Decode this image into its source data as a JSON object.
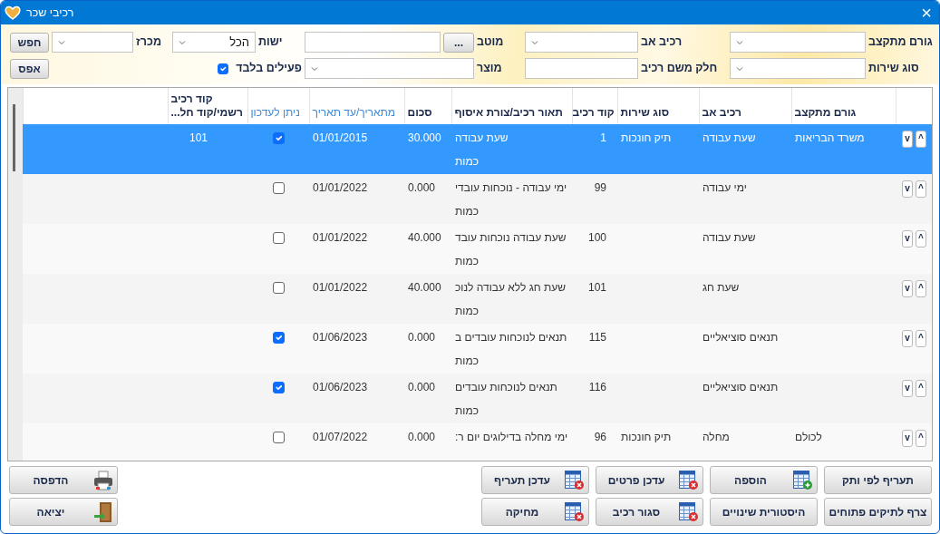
{
  "window": {
    "title": "רכיבי שכר",
    "close": "×"
  },
  "filter_rows": [
    [
      {
        "kind": "label",
        "text": "גורם מתקצב"
      },
      {
        "kind": "select"
      },
      {
        "kind": "label",
        "text": "רכיב אב"
      },
      {
        "kind": "select"
      },
      {
        "kind": "label",
        "text": "מוטב"
      },
      {
        "kind": "button",
        "text": "..."
      },
      {
        "kind": "input"
      },
      {
        "kind": "label",
        "text": "ישות"
      },
      {
        "kind": "select",
        "value": "הכל"
      },
      {
        "kind": "label",
        "text": "מכרז"
      },
      {
        "kind": "select"
      },
      {
        "kind": "button",
        "text": "חפש"
      }
    ],
    [
      {
        "kind": "label",
        "text": "סוג שירות"
      },
      {
        "kind": "select"
      },
      {
        "kind": "label",
        "text": "חלק משם רכיב"
      },
      {
        "kind": "input"
      },
      {
        "kind": "label",
        "text": "מוצר"
      },
      {
        "kind": "wide-select"
      },
      {
        "kind": "checkbox",
        "text": "פעילים בלבד",
        "checked": true
      },
      {
        "kind": "button",
        "text": "אפס"
      }
    ]
  ],
  "table": {
    "columns": [
      {
        "label": "גורם מתקצב",
        "highlighted": false
      },
      {
        "label": "רכיב אב",
        "highlighted": false
      },
      {
        "label": "סוג שירות",
        "highlighted": false
      },
      {
        "label": "קוד רכיב",
        "highlighted": false
      },
      {
        "label": "תאור רכיב/צורת איסוף",
        "highlighted": false
      },
      {
        "label": "סכום",
        "highlighted": false
      },
      {
        "label": "מתאריך/עד תאריך",
        "highlighted": true
      },
      {
        "label": "ניתן לעדכון",
        "highlighted": true
      },
      {
        "label": "קוד רכיב\nרשמי/קוד חל...",
        "highlighted": false
      }
    ],
    "rows": [
      {
        "selected": true,
        "move_up": "^",
        "move_down": "v",
        "funder": "משרד הבריאות",
        "parent": "שעת עבודה",
        "service": "תיק חונכות",
        "code": "1",
        "description": "שעת עבודה",
        "unit": "כמות",
        "amount": "30.000",
        "date": "01/01/2015",
        "updatable": true,
        "official_code": "101"
      },
      {
        "selected": false,
        "move_up": "^",
        "move_down": "v",
        "parent": "ימי עבודה",
        "code": "99",
        "description": "ימי עבודה - נוכחות עובדי",
        "unit": "כמות",
        "amount": "0.000",
        "date": "01/01/2022",
        "updatable": false
      },
      {
        "selected": false,
        "move_up": "^",
        "move_down": "v",
        "parent": "שעת עבודה",
        "code": "100",
        "description": "שעת עבודה נוכחות עובד",
        "unit": "כמות",
        "amount": "40.000",
        "date": "01/01/2022",
        "updatable": false
      },
      {
        "selected": false,
        "move_up": "^",
        "move_down": "v",
        "parent": "שעת חג",
        "code": "101",
        "description": "שעת חג ללא עבודה לנוכ",
        "unit": "כמות",
        "amount": "40.000",
        "date": "01/01/2022",
        "updatable": false
      },
      {
        "selected": false,
        "move_up": "^",
        "move_down": "v",
        "parent": "תנאים סוציאליים",
        "code": "115",
        "description": "תנאים לנוכחות עובדים ב",
        "unit": "כמות",
        "amount": "0.000",
        "date": "01/06/2023",
        "updatable": true
      },
      {
        "selected": false,
        "move_up": "^",
        "move_down": "v",
        "parent": "תנאים סוציאליים",
        "code": "116",
        "description": "תנאים לנוכחות עובדים",
        "unit": "כמות",
        "amount": "0.000",
        "date": "01/06/2023",
        "updatable": true
      },
      {
        "selected": false,
        "move_up": "^",
        "move_down": "v",
        "funder": "לכולם",
        "parent": "מחלה",
        "service": "תיק חונכות",
        "code": "96",
        "description": "ימי מחלה בדילוגים יום ר:",
        "amount": "0.000",
        "date": "01/07/2022",
        "updatable": false
      }
    ]
  },
  "action_buttons": [
    {
      "label": "תעריף לפי ותק"
    },
    {
      "label": "הוספה",
      "kind": "grid-add"
    },
    {
      "label": "עדכן פרטים",
      "kind": "grid-delete"
    },
    {
      "label": "עדכן תעריף",
      "kind": "grid-delete"
    },
    {
      "label": "צרף לתיקים פתוחים"
    },
    {
      "label": "היסטורית שינויים"
    },
    {
      "label": "סגור רכיב",
      "kind": "grid-delete"
    },
    {
      "label": "מחיקה",
      "kind": "grid-delete"
    }
  ],
  "side_buttons": [
    {
      "label": "הדפסה",
      "kind": "printer"
    },
    {
      "label": "יציאה",
      "kind": "door"
    }
  ]
}
